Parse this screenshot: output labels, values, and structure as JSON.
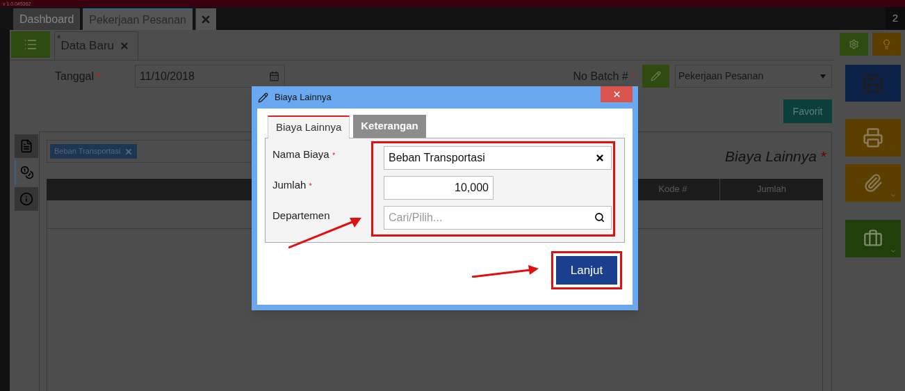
{
  "top_bar": {
    "version": "v 1.0.0#5362"
  },
  "app_tabs": [
    {
      "label": "Dashboard",
      "selected": false
    },
    {
      "label": "Pekerjaan Pesanan",
      "selected": true
    }
  ],
  "tab_count": "2",
  "doc_tab": {
    "modified_mark": "*",
    "label": "Data Baru"
  },
  "form": {
    "date_label": "Tanggal",
    "date_required_mark": "*",
    "date_value": "11/10/2018",
    "batch_label": "No Batch #",
    "batch_required_mark": "*",
    "batch_select": "Pekerjaan Pesanan"
  },
  "favorite_button": "Favorit",
  "side_tabs": [
    {
      "kind": "list",
      "selected": false
    },
    {
      "kind": "coins",
      "selected": true
    },
    {
      "kind": "info",
      "selected": false
    }
  ],
  "panel": {
    "chips": [
      {
        "label": "Beban Transportasi"
      }
    ],
    "title": "Biaya Lainnya",
    "title_mark": "*",
    "columns": [
      "Kode #",
      "Jumlah"
    ]
  },
  "dialog": {
    "title": "Biaya Lainnya",
    "tabs": [
      {
        "label": "Biaya Lainnya",
        "selected": true
      },
      {
        "label": "Keterangan",
        "selected": false
      }
    ],
    "fields": [
      {
        "kind": "lookup",
        "label": "Nama Biaya",
        "required_mark": "*",
        "value": "Beban Transportasi"
      },
      {
        "kind": "number",
        "label": "Jumlah",
        "required_mark": "*",
        "value": "10,000"
      },
      {
        "kind": "search",
        "label": "Departemen",
        "placeholder": "Cari/Pilih..."
      }
    ],
    "submit": "Lanjut"
  }
}
